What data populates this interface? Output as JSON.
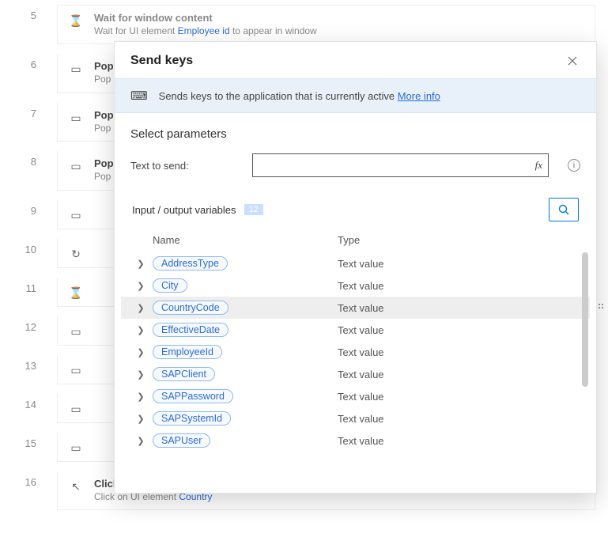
{
  "steps": [
    {
      "num": "5",
      "icon": "⌛",
      "title": "Wait for window content",
      "sub_pre": "Wait for UI element ",
      "sub_link": "Employee id",
      "sub_post": " to appear in window",
      "title_grey": true
    },
    {
      "num": "6",
      "icon": "▭",
      "title": "Pop",
      "sub_pre": "Pop",
      "sub_link": "",
      "sub_post": ""
    },
    {
      "num": "7",
      "icon": "▭",
      "title": "Pop",
      "sub_pre": "Pop",
      "sub_link": "",
      "sub_post": ""
    },
    {
      "num": "8",
      "icon": "▭",
      "title": "Pop",
      "sub_pre": "Pop",
      "sub_link": "",
      "sub_post": ""
    },
    {
      "num": "9",
      "icon": "▭",
      "title": "",
      "sub_pre": "",
      "sub_link": "",
      "sub_post": ""
    },
    {
      "num": "10",
      "icon": "↻",
      "title": "",
      "sub_pre": "",
      "sub_link": "",
      "sub_post": ""
    },
    {
      "num": "11",
      "icon": "⌛",
      "title": "",
      "sub_pre": "",
      "sub_link": "",
      "sub_post": ""
    },
    {
      "num": "12",
      "icon": "▭",
      "title": "",
      "sub_pre": "",
      "sub_link": "",
      "sub_post": ""
    },
    {
      "num": "13",
      "icon": "▭",
      "title": "",
      "sub_pre": "",
      "sub_link": "",
      "sub_post": ""
    },
    {
      "num": "14",
      "icon": "▭",
      "title": "",
      "sub_pre": "",
      "sub_link": "",
      "sub_post": ""
    },
    {
      "num": "15",
      "icon": "▭",
      "title": "",
      "sub_pre": "",
      "sub_link": "",
      "sub_post": ""
    },
    {
      "num": "16",
      "icon": "↖",
      "title": "Click UI element in window",
      "sub_pre": "Click on UI element ",
      "sub_link": "Country",
      "sub_post": ""
    }
  ],
  "dialog": {
    "title": "Send keys",
    "banner": {
      "icon": "⌨",
      "text": "Sends keys to the application that is currently active ",
      "more": "More info"
    },
    "section_title": "Select parameters",
    "param_label": "Text to send:",
    "param_value": "",
    "fx": "fx",
    "vars_header": "Input / output variables",
    "vars_count": "12",
    "col_name": "Name",
    "col_type": "Type",
    "variables": [
      {
        "name": "AddressType",
        "type": "Text value",
        "active": false
      },
      {
        "name": "City",
        "type": "Text value",
        "active": false
      },
      {
        "name": "CountryCode",
        "type": "Text value",
        "active": true
      },
      {
        "name": "EffectiveDate",
        "type": "Text value",
        "active": false
      },
      {
        "name": "EmployeeId",
        "type": "Text value",
        "active": false
      },
      {
        "name": "SAPClient",
        "type": "Text value",
        "active": false
      },
      {
        "name": "SAPPassword",
        "type": "Text value",
        "active": false
      },
      {
        "name": "SAPSystemId",
        "type": "Text value",
        "active": false
      },
      {
        "name": "SAPUser",
        "type": "Text value",
        "active": false
      }
    ]
  }
}
